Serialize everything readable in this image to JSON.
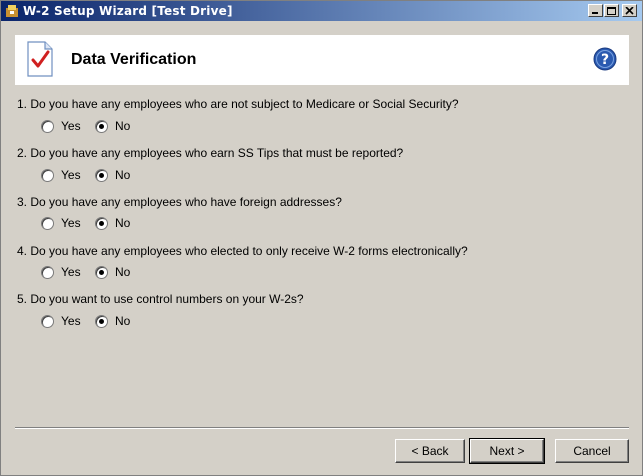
{
  "window": {
    "title": "W-2 Setup Wizard [Test Drive]"
  },
  "header": {
    "title": "Data Verification"
  },
  "questions": [
    {
      "text": "1. Do you have any employees who are not subject to Medicare or Social Security?",
      "yes_label": "Yes",
      "no_label": "No",
      "selected": "No"
    },
    {
      "text": "2. Do you have any employees who earn SS Tips that must be reported?",
      "yes_label": "Yes",
      "no_label": "No",
      "selected": "No"
    },
    {
      "text": "3. Do you have any employees who have foreign addresses?",
      "yes_label": "Yes",
      "no_label": "No",
      "selected": "No"
    },
    {
      "text": "4. Do you have any employees who elected to only receive W-2 forms electronically?",
      "yes_label": "Yes",
      "no_label": "No",
      "selected": "No"
    },
    {
      "text": "5. Do you want to use control numbers on your W-2s?",
      "yes_label": "Yes",
      "no_label": "No",
      "selected": "No"
    }
  ],
  "buttons": {
    "back": "< Back",
    "next": "Next >",
    "cancel": "Cancel"
  },
  "icons": {
    "app": "w2-app-icon",
    "header": "checklist-document-icon",
    "help": "help-icon"
  },
  "colors": {
    "titlebar_start": "#0a246a",
    "titlebar_end": "#a6caf0",
    "help_blue": "#2a5ab0",
    "check_red": "#d02020"
  }
}
